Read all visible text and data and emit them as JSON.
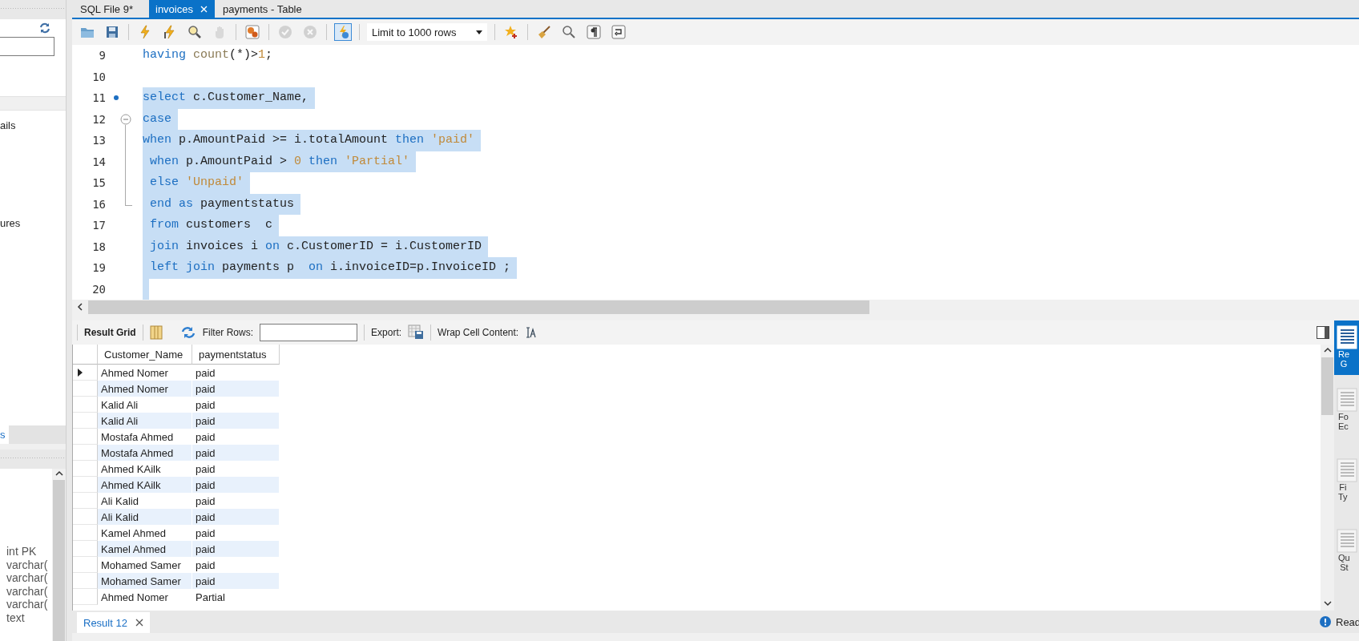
{
  "left_panel": {
    "items": [
      "ails",
      "ures"
    ],
    "tabs": [
      {
        "label": "s",
        "selected": true
      }
    ],
    "column_types": [
      "int PK",
      "varchar(",
      "varchar(",
      "varchar(",
      "varchar(",
      "text"
    ]
  },
  "tabs": [
    {
      "label": "SQL File 9*",
      "selected": false
    },
    {
      "label": "invoices",
      "selected": true
    },
    {
      "label": "payments - Table",
      "selected": false
    }
  ],
  "toolbar": {
    "buttons": [
      {
        "disabled": false,
        "pressed": false
      },
      {
        "disabled": false,
        "pressed": false
      },
      {
        "disabled": false,
        "pressed": false
      },
      {
        "disabled": false,
        "pressed": false
      },
      {
        "disabled": false,
        "pressed": false
      },
      {
        "disabled": true,
        "pressed": false
      },
      {
        "disabled": false,
        "pressed": false
      },
      {
        "disabled": true,
        "pressed": false
      },
      {
        "disabled": true,
        "pressed": false
      },
      {
        "disabled": false,
        "pressed": true
      }
    ],
    "limit": "Limit to 1000 rows"
  },
  "editor": {
    "lines": [
      {
        "number": "9",
        "selected": false,
        "current_statement": false,
        "tokens": [
          {
            "kind": "keyword",
            "text": "having"
          },
          {
            "kind": "function",
            "text": " count"
          },
          {
            "kind": "plain",
            "text": "(*)>"
          },
          {
            "kind": "number",
            "text": "1"
          },
          {
            "kind": "plain",
            "text": ";"
          }
        ]
      },
      {
        "number": "10",
        "selected": false,
        "current_statement": false
      },
      {
        "number": "11",
        "selected": true,
        "current_statement": true,
        "tokens": [
          {
            "kind": "keyword",
            "text": "select"
          },
          {
            "kind": "plain",
            "text": " c.Customer_Name,"
          }
        ]
      },
      {
        "number": "12",
        "selected": true,
        "current_statement": false,
        "expanded": true,
        "tokens": [
          {
            "kind": "keyword",
            "text": "case"
          }
        ],
        "children": [
          {
            "number": "13",
            "selected": true,
            "current_statement": false,
            "tokens": [
              {
                "kind": "keyword",
                "text": "when"
              },
              {
                "kind": "plain",
                "text": " p.AmountPaid >= i.totalAmount "
              },
              {
                "kind": "keyword",
                "text": "then"
              },
              {
                "kind": "string",
                "text": " 'paid'"
              }
            ]
          },
          {
            "number": "14",
            "selected": true,
            "current_statement": false,
            "tokens": [
              {
                "kind": "keyword",
                "text": " when"
              },
              {
                "kind": "plain",
                "text": " p.AmountPaid > "
              },
              {
                "kind": "number",
                "text": "0"
              },
              {
                "kind": "keyword",
                "text": " then"
              },
              {
                "kind": "string",
                "text": " 'Partial'"
              }
            ]
          },
          {
            "number": "15",
            "selected": true,
            "current_statement": false,
            "tokens": [
              {
                "kind": "keyword",
                "text": " else"
              },
              {
                "kind": "string",
                "text": " 'Unpaid'"
              }
            ]
          },
          {
            "number": "16",
            "selected": true,
            "current_statement": false,
            "tokens": [
              {
                "kind": "keyword",
                "text": " end as"
              },
              {
                "kind": "plain",
                "text": " paymentstatus"
              }
            ]
          }
        ]
      },
      {
        "number": "17",
        "selected": true,
        "current_statement": false,
        "tokens": [
          {
            "kind": "keyword",
            "text": " from"
          },
          {
            "kind": "plain",
            "text": " customers  c"
          }
        ]
      },
      {
        "number": "18",
        "selected": true,
        "current_statement": false,
        "tokens": [
          {
            "kind": "keyword",
            "text": " join"
          },
          {
            "kind": "plain",
            "text": " invoices i "
          },
          {
            "kind": "keyword",
            "text": "on"
          },
          {
            "kind": "plain",
            "text": " c.CustomerID = i.CustomerID"
          }
        ]
      },
      {
        "number": "19",
        "selected": true,
        "current_statement": false,
        "tokens": [
          {
            "kind": "keyword",
            "text": " left join"
          },
          {
            "kind": "plain",
            "text": " payments p  "
          },
          {
            "kind": "keyword",
            "text": "on"
          },
          {
            "kind": "plain",
            "text": " i.invoiceID=p.InvoiceID ;"
          }
        ]
      },
      {
        "number": "20",
        "selected": true,
        "current_statement": false
      }
    ]
  },
  "result_toolbar": {
    "grid_label": "Result Grid",
    "filter_label": "Filter Rows:",
    "export_label": "Export:",
    "wrap_label": "Wrap Cell Content:"
  },
  "result_grid": {
    "columns": [
      "Customer_Name",
      "paymentstatus"
    ],
    "rows": [
      {
        "current": true,
        "cells": [
          "Ahmed Nomer",
          "paid"
        ]
      },
      {
        "current": false,
        "cells": [
          "Ahmed Nomer",
          "paid"
        ]
      },
      {
        "current": false,
        "cells": [
          "Kalid Ali",
          "paid"
        ]
      },
      {
        "current": false,
        "cells": [
          "Kalid Ali",
          "paid"
        ]
      },
      {
        "current": false,
        "cells": [
          "Mostafa Ahmed",
          "paid"
        ]
      },
      {
        "current": false,
        "cells": [
          "Mostafa Ahmed",
          "paid"
        ]
      },
      {
        "current": false,
        "cells": [
          "Ahmed KAilk",
          "paid"
        ]
      },
      {
        "current": false,
        "cells": [
          "Ahmed KAilk",
          "paid"
        ]
      },
      {
        "current": false,
        "cells": [
          "Ali Kalid",
          "paid"
        ]
      },
      {
        "current": false,
        "cells": [
          "Ali Kalid",
          "paid"
        ]
      },
      {
        "current": false,
        "cells": [
          "Kamel Ahmed",
          "paid"
        ]
      },
      {
        "current": false,
        "cells": [
          "Kamel Ahmed",
          "paid"
        ]
      },
      {
        "current": false,
        "cells": [
          "Mohamed Samer",
          "paid"
        ]
      },
      {
        "current": false,
        "cells": [
          "Mohamed Samer",
          "paid"
        ]
      },
      {
        "current": false,
        "cells": [
          "Ahmed Nomer",
          "Partial"
        ]
      }
    ]
  },
  "result_tabs": [
    {
      "label": "Result 12",
      "selected": true
    }
  ],
  "side_panel": {
    "items": [
      {
        "lines": [
          "Re",
          "G"
        ],
        "selected": true
      },
      {
        "lines": [
          "Fo",
          "Ec"
        ],
        "selected": false
      },
      {
        "lines": [
          "Fi",
          "Ty"
        ],
        "selected": false
      },
      {
        "lines": [
          "Qu",
          "St"
        ],
        "selected": false
      }
    ]
  },
  "status": "Read"
}
